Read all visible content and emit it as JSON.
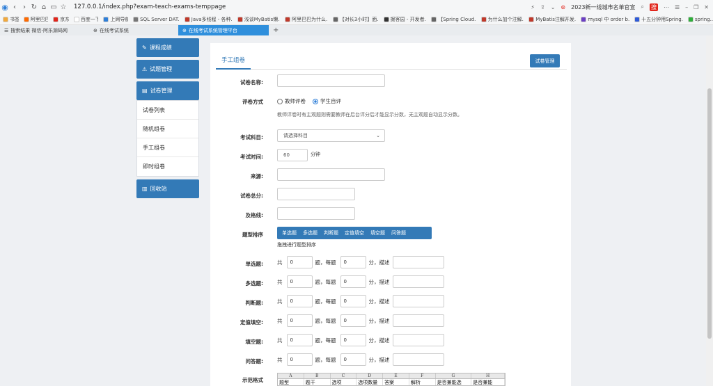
{
  "browser": {
    "url": "127.0.0.1/index.php?exam-teach-exams-temppage",
    "hot_search": "2023新一线城市名单官宣",
    "hot_badge": "搜"
  },
  "bookmarks": [
    {
      "label": "书签",
      "color": "#f2a93b"
    },
    {
      "label": "阿里巴巴",
      "color": "#ff6a00"
    },
    {
      "label": "京东",
      "color": "#e1251b"
    },
    {
      "label": "百度一下",
      "color": "#ffffff"
    },
    {
      "label": "上网导航",
      "color": "#2f7fd8"
    },
    {
      "label": "SQL Server DAT...",
      "color": "#777777"
    },
    {
      "label": "Java多线程 - 各种...",
      "color": "#c0392b"
    },
    {
      "label": "浅谈MyBatis懒...",
      "color": "#c0392b"
    },
    {
      "label": "阿里巴巴为什么...",
      "color": "#c0392b"
    },
    {
      "label": "【对长3小时】面...",
      "color": "#666666"
    },
    {
      "label": "掘客园 - 开发者...",
      "color": "#333333"
    },
    {
      "label": "【Spring Cloud...",
      "color": "#666666"
    },
    {
      "label": "为什么加个注解...",
      "color": "#c0392b"
    },
    {
      "label": "MyBatis注解开发...",
      "color": "#c0392b"
    },
    {
      "label": "mysql 中 order b...",
      "color": "#6c3fc4"
    },
    {
      "label": "十五分钟用Spring...",
      "color": "#2f5bd8"
    },
    {
      "label": "spring...",
      "color": "#2fae3b"
    }
  ],
  "tabs": [
    {
      "label": "搜索结果 微信-阿乐源码网"
    },
    {
      "label": "在线考试系统"
    },
    {
      "label": "在线考试系统管理平台"
    }
  ],
  "sidebar": {
    "top_items": [
      {
        "label": "课程成绩",
        "icon": "wrench-icon"
      },
      {
        "label": "试题管理",
        "icon": "warning-icon"
      },
      {
        "label": "试卷管理",
        "icon": "book-icon"
      }
    ],
    "sub_items": [
      "试卷列表",
      "随机组卷",
      "手工组卷",
      "即时组卷"
    ],
    "bottom_item": {
      "label": "回收站",
      "icon": "trash-icon"
    }
  },
  "panel": {
    "tab": "手工组卷",
    "manage_button": "试卷管理"
  },
  "form": {
    "name_label": "试卷名称:",
    "eval_label": "评卷方式",
    "eval_options": [
      "教师评卷",
      "学生自评"
    ],
    "eval_selected": "学生自评",
    "eval_hint": "教师评卷时有主观题则需要教师在后台评分后才能显示分数，无主观题自动显示分数。",
    "subject_label": "考试科目:",
    "subject_value": "请选择科目",
    "time_label": "考试时间:",
    "time_value": "60",
    "time_unit": "分钟",
    "source_label": "来源:",
    "total_label": "试卷总分:",
    "pass_label": "及格线:",
    "sort_label": "题型排序",
    "sort_items": [
      "单选题",
      "多选题",
      "判断题",
      "定值填空",
      "填空题",
      "问答题"
    ],
    "sort_hint": "拖拽进行题型排序",
    "example_label": "示范格式"
  },
  "question_types": [
    {
      "label": "单选题:",
      "count": "0",
      "score": "0"
    },
    {
      "label": "多选题:",
      "count": "0",
      "score": "0"
    },
    {
      "label": "判断题:",
      "count": "0",
      "score": "0"
    },
    {
      "label": "定值填空:",
      "count": "0",
      "score": "0"
    },
    {
      "label": "填空题:",
      "count": "0",
      "score": "0"
    },
    {
      "label": "问答题:",
      "count": "0",
      "score": "0"
    }
  ],
  "row_text": {
    "total": "共",
    "per": "题，每题",
    "points": "分，描述"
  },
  "sheet": {
    "columns": [
      "A",
      "B",
      "C",
      "D",
      "E",
      "F",
      "G",
      "H"
    ],
    "row1": [
      "题型",
      "题干",
      "选项",
      "选项数量",
      "答案",
      "解析",
      "是否兼能选",
      "是否兼能"
    ]
  }
}
